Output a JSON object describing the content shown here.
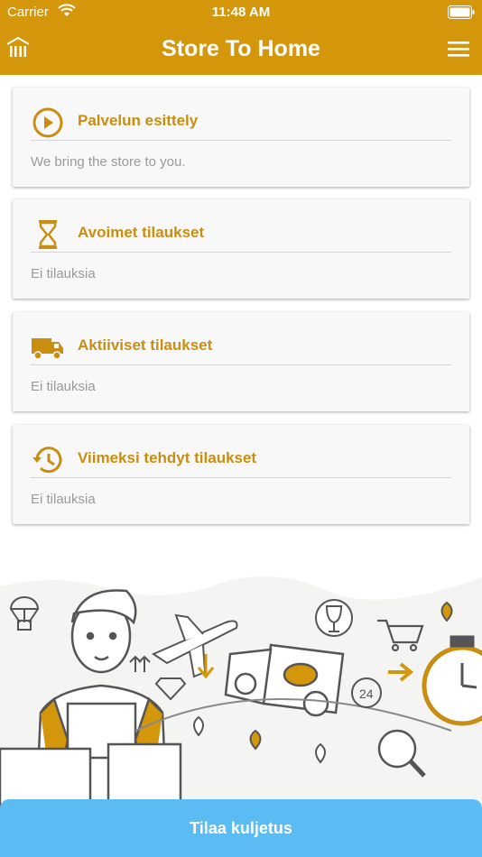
{
  "status": {
    "carrier": "Carrier",
    "time": "11:48 AM"
  },
  "header": {
    "title": "Store To Home",
    "logo_icon": "bank-building-icon",
    "menu_icon": "hamburger-menu-icon"
  },
  "colors": {
    "primary": "#d4960a",
    "accent_text": "#c98d12",
    "cta": "#5bbcf4"
  },
  "cards": [
    {
      "icon": "play-circle-icon",
      "title": "Palvelun esittely",
      "subtitle": "We bring the store to you."
    },
    {
      "icon": "hourglass-icon",
      "title": "Avoimet tilaukset",
      "subtitle": "Ei tilauksia"
    },
    {
      "icon": "delivery-truck-icon",
      "title": "Aktiiviset tilaukset",
      "subtitle": "Ei tilauksia"
    },
    {
      "icon": "history-clock-icon",
      "title": "Viimeksi tehdyt tilaukset",
      "subtitle": "Ei tilauksia"
    }
  ],
  "cta": {
    "label": "Tilaa kuljetus"
  }
}
